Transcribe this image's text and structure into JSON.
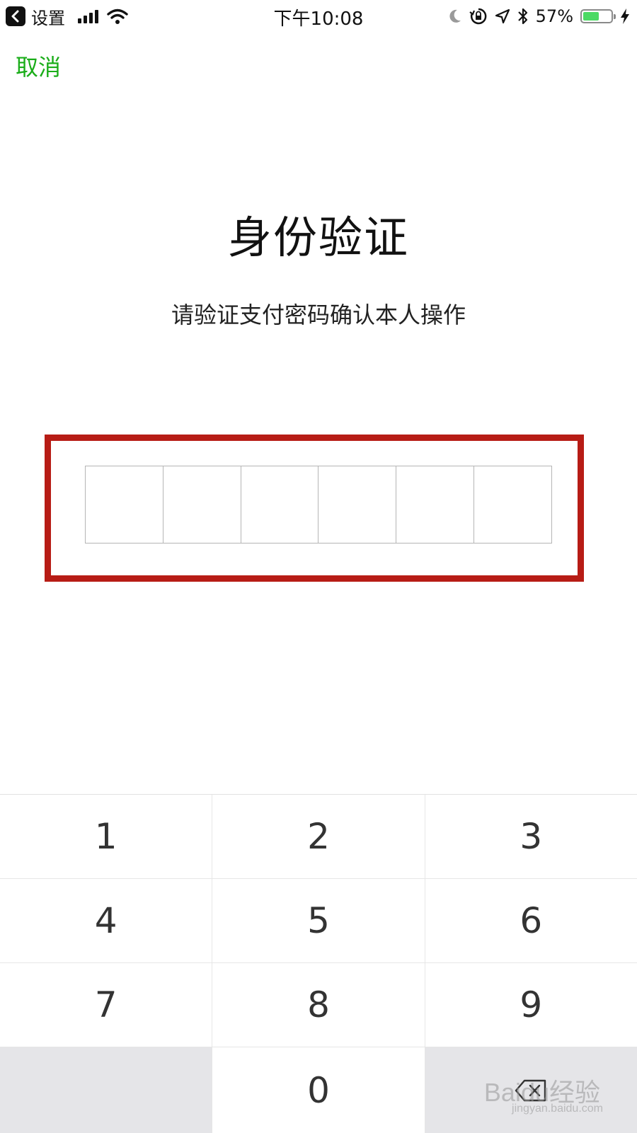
{
  "status_bar": {
    "back_app": "设置",
    "time": "下午10:08",
    "battery_percent": "57%",
    "battery_level": 0.57,
    "battery_color": "#4cd964"
  },
  "nav": {
    "cancel_label": "取消",
    "accent_color": "#1aad19"
  },
  "main": {
    "title": "身份验证",
    "subtitle": "请验证支付密码确认本人操作",
    "pin_length": 6,
    "highlight_color": "#b71c15"
  },
  "keypad": {
    "keys": [
      "1",
      "2",
      "3",
      "4",
      "5",
      "6",
      "7",
      "8",
      "9",
      "",
      "0",
      "delete"
    ]
  },
  "watermark": {
    "text": "Baidu经验",
    "sub": "jingyan.baidu.com"
  }
}
